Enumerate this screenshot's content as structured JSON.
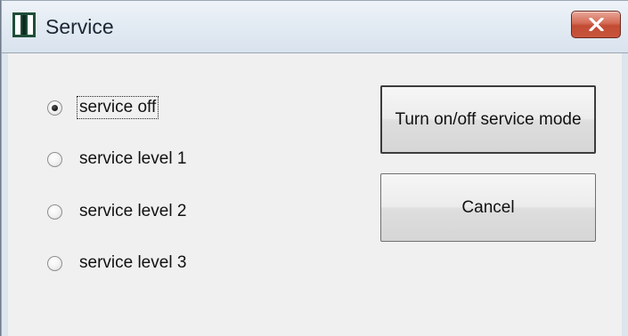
{
  "window": {
    "title": "Service",
    "icon": "app-icon",
    "close_icon": "close-icon"
  },
  "options": [
    {
      "label": "service off",
      "checked": true
    },
    {
      "label": "service level 1",
      "checked": false
    },
    {
      "label": "service level 2",
      "checked": false
    },
    {
      "label": "service level 3",
      "checked": false
    }
  ],
  "buttons": {
    "toggle_label": "Turn on/off service mode",
    "cancel_label": "Cancel"
  }
}
